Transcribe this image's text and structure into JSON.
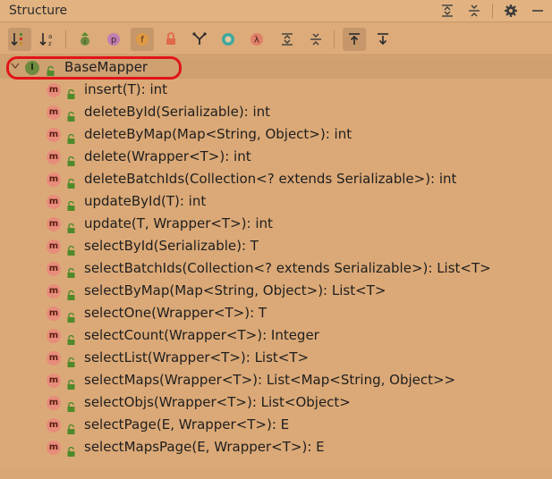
{
  "panel": {
    "title": "Structure"
  },
  "title_actions": [
    {
      "name": "expand-all-icon"
    },
    {
      "name": "collapse-all-icon"
    },
    {
      "name": "gear-icon"
    },
    {
      "name": "minimize-icon"
    }
  ],
  "toolbar": {
    "buttons": [
      {
        "name": "sort-by-visibility-icon",
        "active": true
      },
      {
        "name": "sort-alphabetically-icon",
        "active": false
      },
      {
        "name": "show-inherited-icon",
        "active": false
      },
      {
        "name": "show-properties-icon",
        "active": false
      },
      {
        "name": "show-fields-icon",
        "active": true
      },
      {
        "name": "show-non-public-icon",
        "active": false
      },
      {
        "name": "show-lambdas-filter-icon",
        "active": false
      },
      {
        "name": "anonymous-classes-icon",
        "active": false
      },
      {
        "name": "lambda-icon",
        "active": false
      },
      {
        "name": "expand-all-toolbar-icon",
        "active": false
      },
      {
        "name": "collapse-all-toolbar-icon",
        "active": false
      },
      {
        "name": "autoscroll-to-source-icon",
        "active": true
      },
      {
        "name": "autoscroll-from-source-icon",
        "active": false
      }
    ],
    "glyphs": {
      "show_properties": "p",
      "show_fields": "f",
      "lambda": "λ"
    }
  },
  "tree": {
    "root": {
      "badge": "I",
      "label": "BaseMapper"
    },
    "method_badge": "m",
    "methods": [
      "insert(T): int",
      "deleteById(Serializable): int",
      "deleteByMap(Map<String, Object>): int",
      "delete(Wrapper<T>): int",
      "deleteBatchIds(Collection<? extends Serializable>): int",
      "updateById(T): int",
      "update(T, Wrapper<T>): int",
      "selectById(Serializable): T",
      "selectBatchIds(Collection<? extends Serializable>): List<T>",
      "selectByMap(Map<String, Object>): List<T>",
      "selectOne(Wrapper<T>): T",
      "selectCount(Wrapper<T>): Integer",
      "selectList(Wrapper<T>): List<T>",
      "selectMaps(Wrapper<T>): List<Map<String, Object>>",
      "selectObjs(Wrapper<T>): List<Object>",
      "selectPage(E, Wrapper<T>): E",
      "selectMapsPage(E, Wrapper<T>): E"
    ]
  },
  "colors": {
    "background": "#dba977",
    "selection": "#cfa072",
    "highlight_ring": "#e0151a",
    "method_badge": "#e88c7b",
    "interface_badge": "#6d8a3f",
    "lock": "#4f8a2a"
  }
}
